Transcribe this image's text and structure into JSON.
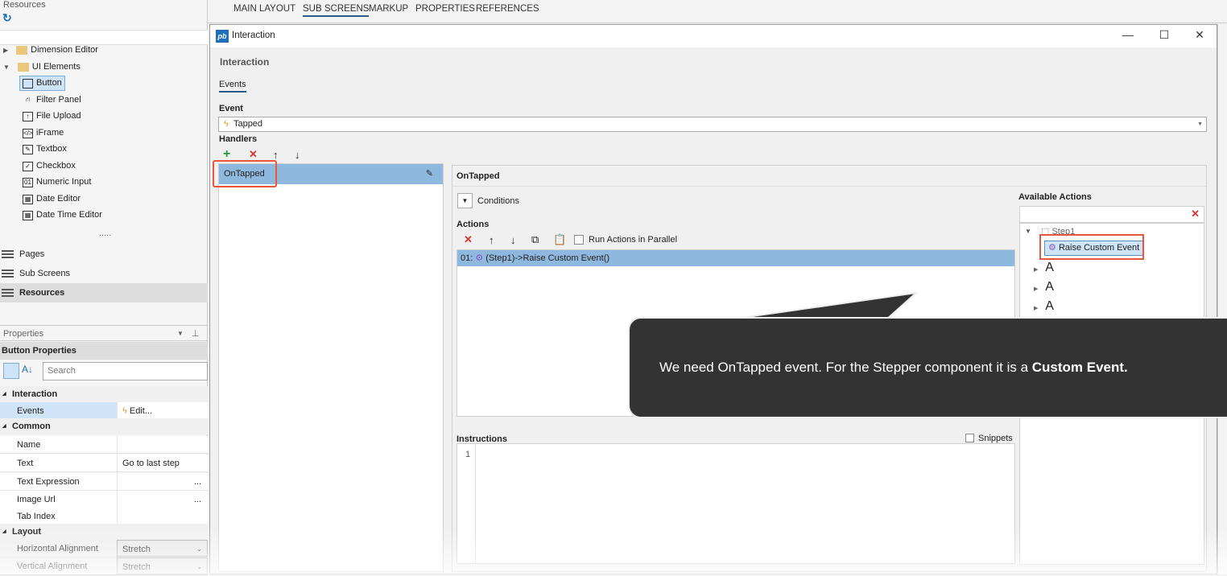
{
  "left_panel": {
    "header": "Resources",
    "tree": [
      {
        "label": "Dimension Editor",
        "type": "folder",
        "expanded": false
      },
      {
        "label": "UI Elements",
        "type": "folder",
        "expanded": true
      },
      {
        "label": "Button",
        "selected": true
      },
      {
        "label": "Filter Panel"
      },
      {
        "label": "File Upload"
      },
      {
        "label": "iFrame"
      },
      {
        "label": "Textbox"
      },
      {
        "label": "Checkbox"
      },
      {
        "label": "Numeric Input"
      },
      {
        "label": "Date Editor"
      },
      {
        "label": "Date Time Editor"
      }
    ],
    "more": ".....",
    "nav": [
      "Pages",
      "Sub Screens",
      "Resources"
    ]
  },
  "properties": {
    "panel_title": "Properties",
    "title": "Button Properties",
    "search_placeholder": "Search",
    "categories": {
      "interaction": "Interaction",
      "common": "Common",
      "layout": "Layout"
    },
    "rows": {
      "events": {
        "key": "Events",
        "value": "Edit..."
      },
      "name": {
        "key": "Name",
        "value": ""
      },
      "text": {
        "key": "Text",
        "value": "Go to last step"
      },
      "text_expression": {
        "key": "Text Expression",
        "value": "..."
      },
      "image_url": {
        "key": "Image Url",
        "value": "..."
      },
      "tab_index": {
        "key": "Tab Index",
        "value": ""
      },
      "h_align": {
        "key": "Horizontal Alignment",
        "value": "Stretch"
      },
      "v_align": {
        "key": "Vertical Alignment",
        "value": "Stretch"
      }
    }
  },
  "top_tabs": [
    "MAIN LAYOUT",
    "SUB SCREENS",
    "MARKUP",
    "PROPERTIES",
    "REFERENCES"
  ],
  "active_top_tab": "SUB SCREENS",
  "dialog": {
    "title": "Interaction",
    "heading": "Interaction",
    "tab": "Events",
    "event_label": "Event",
    "event_value": "Tapped",
    "handlers_label": "Handlers",
    "handlers": [
      "OnTapped"
    ],
    "detail_title": "OnTapped",
    "conditions": "Conditions",
    "actions_label": "Actions",
    "run_parallel": "Run Actions in Parallel",
    "actions": [
      {
        "index": "01:",
        "text": "(Step1)->Raise Custom Event()"
      }
    ],
    "available_actions_label": "Available Actions",
    "tree_root": "Step1",
    "tree_selected": "Raise Custom Event",
    "tree_more": [
      "A",
      "A",
      "A",
      "A"
    ],
    "instructions_label": "Instructions",
    "snippets": "Snippets",
    "line_number": "1"
  },
  "callout": {
    "text": "We need OnTapped event. For the Stepper component it is a ",
    "bold": "Custom Event."
  },
  "colors": {
    "selection": "#8fb8de",
    "highlight_red": "#e8563f",
    "callout_bg": "#333333",
    "accent": "#1e6fb8"
  }
}
